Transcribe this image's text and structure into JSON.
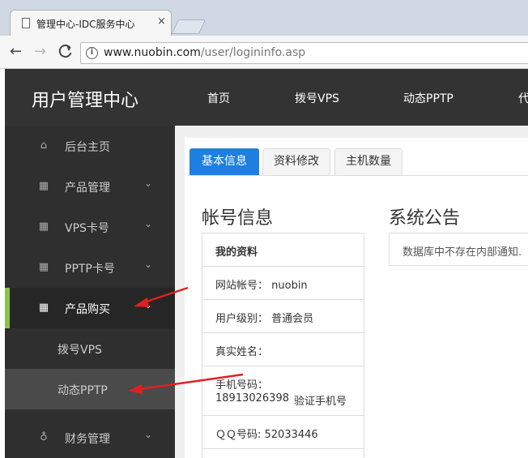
{
  "browser": {
    "tab_title": "管理中心-IDC服务中心",
    "close_glyph": "×",
    "back_glyph": "←",
    "forward_glyph": "→",
    "reload_glyph": "C",
    "info_glyph": "i",
    "url_host": "www.nuobin.com",
    "url_path": "/user/logininfo.asp"
  },
  "header": {
    "brand": "用户管理中心",
    "nav": [
      "首页",
      "拨号VPS",
      "动态PPTP",
      "代"
    ]
  },
  "sidebar": {
    "items": [
      {
        "label": "后台主页",
        "icon": "⌂"
      },
      {
        "label": "产品管理",
        "icon": "▦",
        "chevron": "⌄"
      },
      {
        "label": "VPS卡号",
        "icon": "▦",
        "chevron": "⌄"
      },
      {
        "label": "PPTP卡号",
        "icon": "▦",
        "chevron": "⌄"
      },
      {
        "label": "产品购买",
        "icon": "▦",
        "chevron": "⌄"
      },
      {
        "label": "财务管理",
        "icon": "♁",
        "chevron": "⌄"
      }
    ],
    "subitems": [
      "拨号VPS",
      "动态PPTP"
    ]
  },
  "content": {
    "tabs": [
      "基本信息",
      "资料修改",
      "主机数量"
    ],
    "account_title": "帐号信息",
    "notice_title": "系统公告",
    "profile_header": "我的资料",
    "site_account": "网站帐号： nuobin",
    "user_level": "用户级别： 普通会员",
    "real_name": "真实姓名：",
    "phone_label": "手机号码：",
    "phone_value": "18913026398",
    "verify_link": "验证手机号",
    "qq": "ＱＱ号码: 52033446",
    "notice_text": "数据库中不存在内部通知."
  },
  "colors": {
    "accent": "#1e7fe0",
    "active_bar": "#8bc34a",
    "annotation_arrow": "#e02020"
  }
}
